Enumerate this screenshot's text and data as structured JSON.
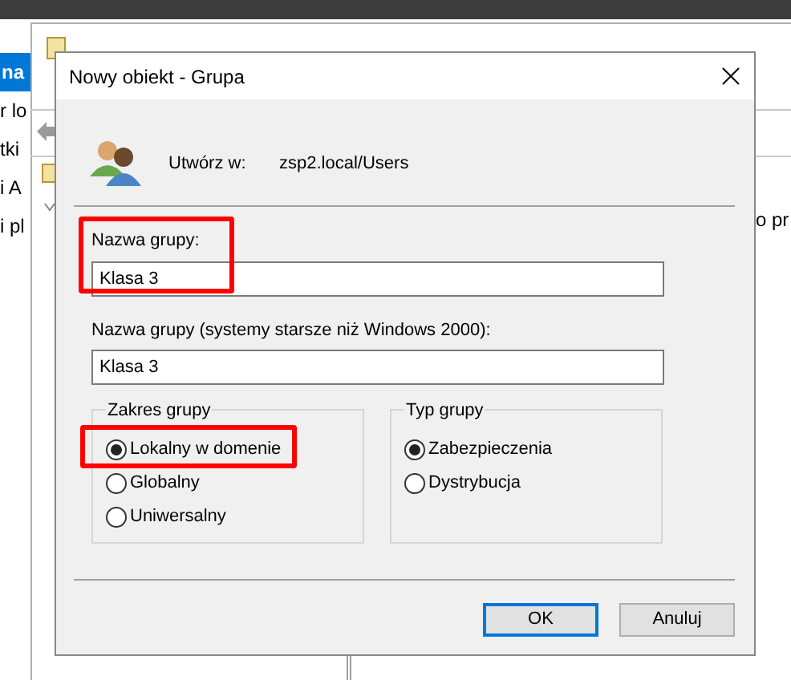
{
  "background": {
    "sidebar_items": [
      {
        "label": "na",
        "selected": true
      },
      {
        "label": "r lo",
        "selected": false
      },
      {
        "label": "tki",
        "selected": false
      },
      {
        "label": "i A",
        "selected": false
      },
      {
        "label": "i pl",
        "selected": false
      }
    ],
    "right_text": "o pr"
  },
  "dialog": {
    "title": "Nowy obiekt - Grupa",
    "create_in_label": "Utwórz w:",
    "create_in_value": "zsp2.local/Users",
    "fields": [
      {
        "label": "Nazwa grupy:",
        "value": "Klasa 3",
        "highlighted": true
      },
      {
        "label": "Nazwa grupy (systemy starsze niż Windows 2000):",
        "value": "Klasa 3"
      }
    ],
    "groups": [
      {
        "title": "Zakres grupy",
        "options": [
          {
            "label": "Lokalny w domenie",
            "selected": true,
            "highlighted": true
          },
          {
            "label": "Globalny",
            "selected": false
          },
          {
            "label": "Uniwersalny",
            "selected": false
          }
        ]
      },
      {
        "title": "Typ grupy",
        "options": [
          {
            "label": "Zabezpieczenia",
            "selected": true
          },
          {
            "label": "Dystrybucja",
            "selected": false
          }
        ]
      }
    ],
    "buttons": [
      {
        "label": "OK",
        "default": true
      },
      {
        "label": "Anuluj",
        "default": false
      }
    ]
  }
}
